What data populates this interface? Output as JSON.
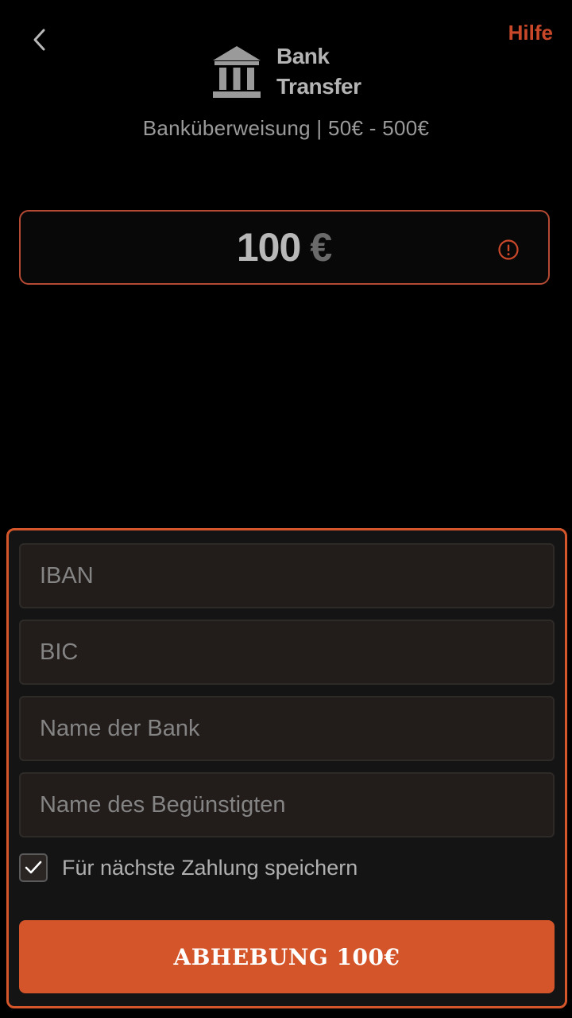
{
  "header": {
    "back_icon": "chevron-left-icon",
    "help_label": "Hilfe",
    "accent_color": "#c9482a"
  },
  "brand": {
    "icon": "bank-icon",
    "line1": "Bank",
    "line2": "Transfer"
  },
  "subtitle": "Banküberweisung | 50€ - 500€",
  "amount": {
    "value": "100",
    "currency": "€",
    "status_icon": "warning-icon"
  },
  "form": {
    "iban_placeholder": "IBAN",
    "bic_placeholder": "BIC",
    "bank_name_placeholder": "Name der Bank",
    "beneficiary_placeholder": "Name des Begünstigten",
    "save_label": "Für nächste Zahlung speichern",
    "save_checked": true,
    "submit_label": "ABHEBUNG 100€",
    "submit_color": "#d4552a",
    "border_color": "#d4562a"
  }
}
